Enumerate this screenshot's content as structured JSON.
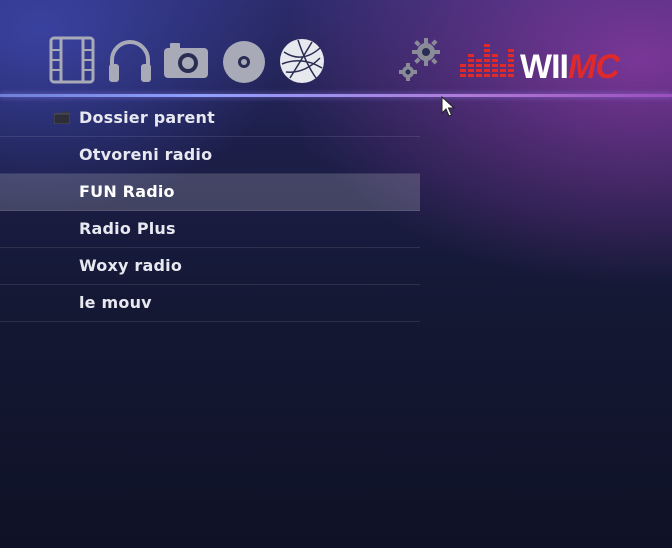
{
  "menu": [
    {
      "name": "video",
      "icon": "film-icon"
    },
    {
      "name": "music",
      "icon": "headphones-icon"
    },
    {
      "name": "photo",
      "icon": "camera-icon"
    },
    {
      "name": "disc",
      "icon": "disc-icon"
    },
    {
      "name": "web",
      "icon": "globe-icon"
    },
    {
      "name": "settings",
      "icon": "gears-icon"
    }
  ],
  "logo_text": "WIIMC",
  "colors": {
    "logo_red": "#e02a2a",
    "accent_line": "#8fa0ff",
    "selected_bg": "#4a4a66"
  },
  "browser": {
    "items": [
      {
        "label": "Dossier parent",
        "type": "folder"
      },
      {
        "label": "Otvoreni radio",
        "type": "station"
      },
      {
        "label": "FUN Radio",
        "type": "station",
        "selected": true
      },
      {
        "label": "Radio Plus",
        "type": "station"
      },
      {
        "label": "Woxy radio",
        "type": "station"
      },
      {
        "label": "le mouv",
        "type": "station"
      }
    ]
  }
}
